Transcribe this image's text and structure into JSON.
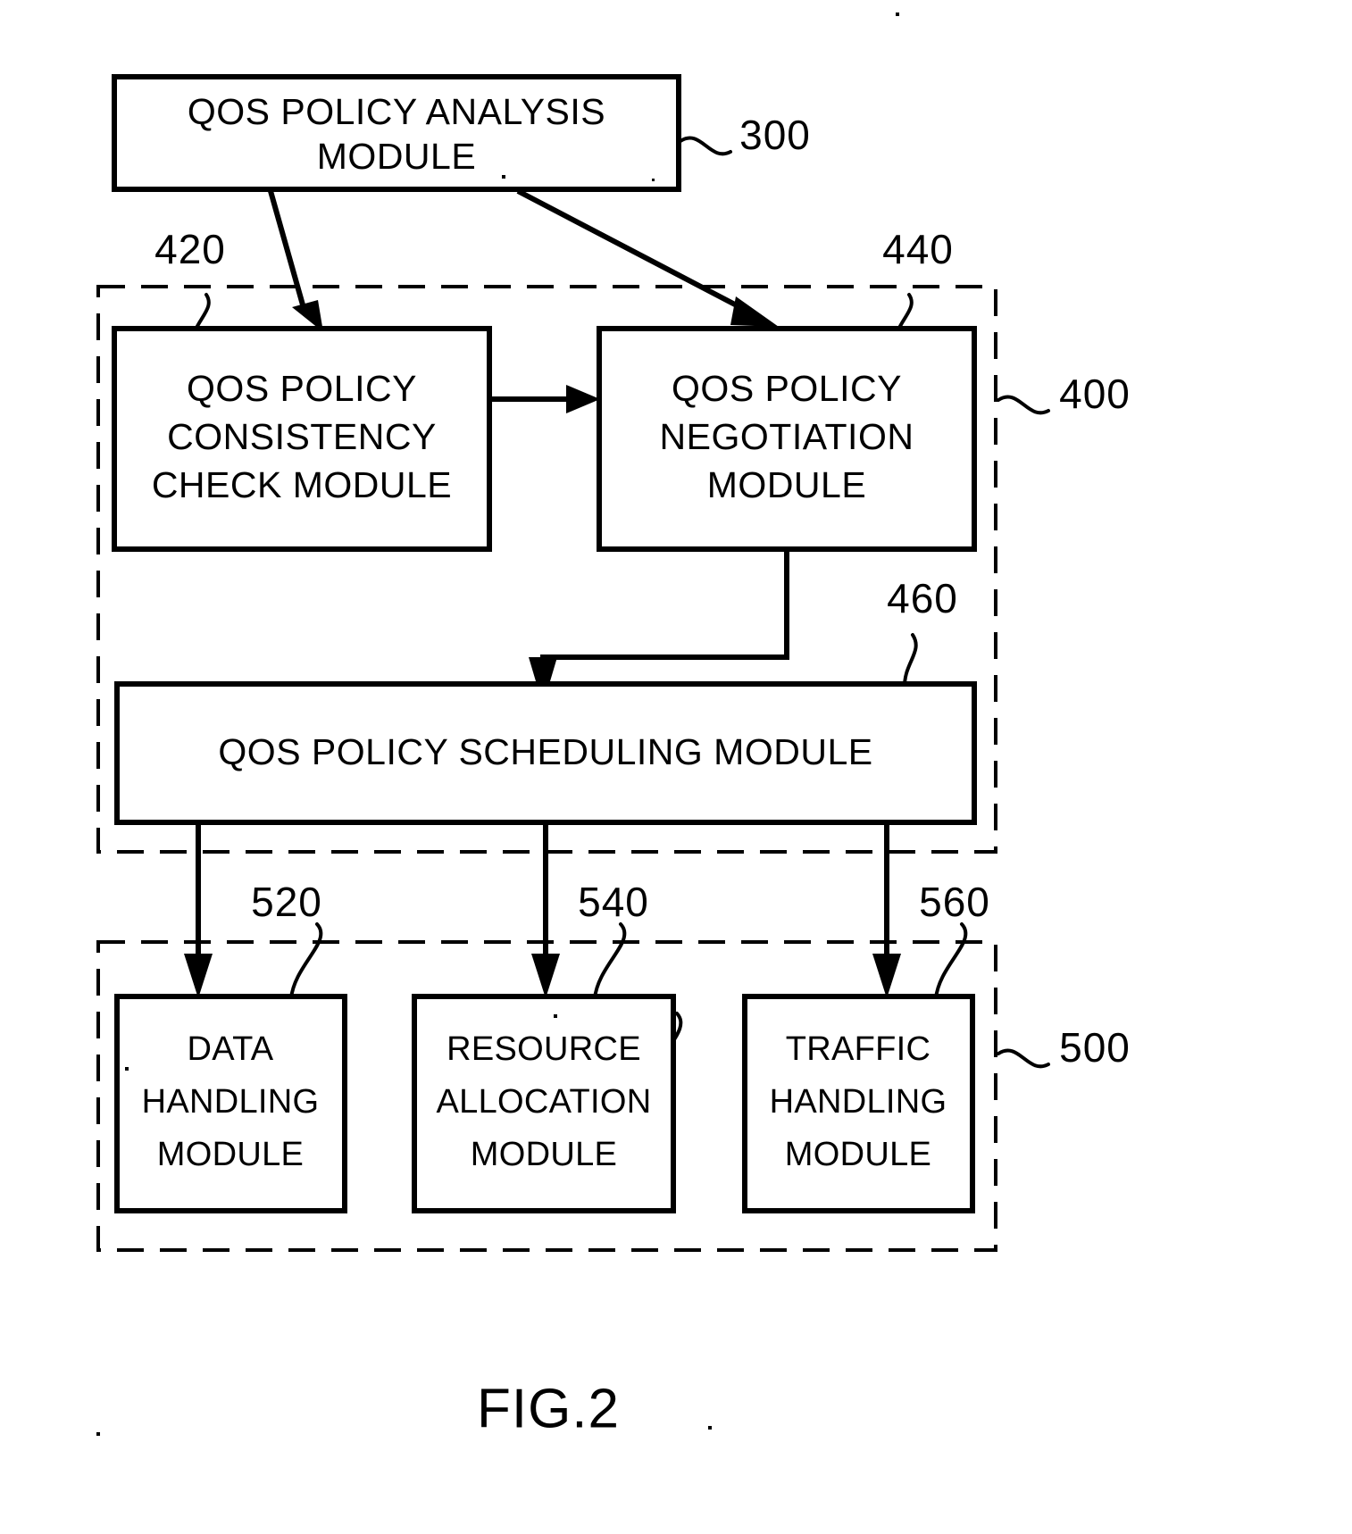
{
  "figure": {
    "caption": "FIG.2",
    "blocks": [
      {
        "id": "analysis",
        "ref": "300",
        "lines": [
          "QOS POLICY ANALYSIS",
          "MODULE"
        ]
      },
      {
        "id": "consistency",
        "ref": "420",
        "lines": [
          "QOS POLICY",
          "CONSISTENCY",
          "CHECK MODULE"
        ]
      },
      {
        "id": "negotiation",
        "ref": "440",
        "lines": [
          "QOS POLICY",
          "NEGOTIATION",
          "MODULE"
        ]
      },
      {
        "id": "scheduling",
        "ref": "460",
        "lines": [
          "QOS POLICY SCHEDULING MODULE"
        ]
      },
      {
        "id": "data-handling",
        "ref": "520",
        "lines": [
          "DATA",
          "HANDLING",
          "MODULE"
        ]
      },
      {
        "id": "resource-allocation",
        "ref": "540",
        "lines": [
          "RESOURCE",
          "ALLOCATION",
          "MODULE"
        ]
      },
      {
        "id": "traffic-handling",
        "ref": "560",
        "lines": [
          "TRAFFIC",
          "HANDLING",
          "MODULE"
        ]
      }
    ],
    "groups": [
      {
        "id": "policy-group",
        "ref": "400"
      },
      {
        "id": "execution-group",
        "ref": "500"
      }
    ],
    "refs": {
      "r300": "300",
      "r420": "420",
      "r440": "440",
      "r400": "400",
      "r460": "460",
      "r520": "520",
      "r540": "540",
      "r560": "560",
      "r500": "500"
    },
    "text": {
      "analysis_l1": "QOS POLICY ANALYSIS",
      "analysis_l2": "MODULE",
      "consistency_l1": "QOS POLICY",
      "consistency_l2": "CONSISTENCY",
      "consistency_l3": "CHECK MODULE",
      "negotiation_l1": "QOS POLICY",
      "negotiation_l2": "NEGOTIATION",
      "negotiation_l3": "MODULE",
      "scheduling_l1": "QOS POLICY SCHEDULING MODULE",
      "data_l1": "DATA",
      "data_l2": "HANDLING",
      "data_l3": "MODULE",
      "resource_l1": "RESOURCE",
      "resource_l2": "ALLOCATION",
      "resource_l3": "MODULE",
      "traffic_l1": "TRAFFIC",
      "traffic_l2": "HANDLING",
      "traffic_l3": "MODULE"
    },
    "colors": {
      "ink": "#000000",
      "paper": "#ffffff"
    }
  }
}
